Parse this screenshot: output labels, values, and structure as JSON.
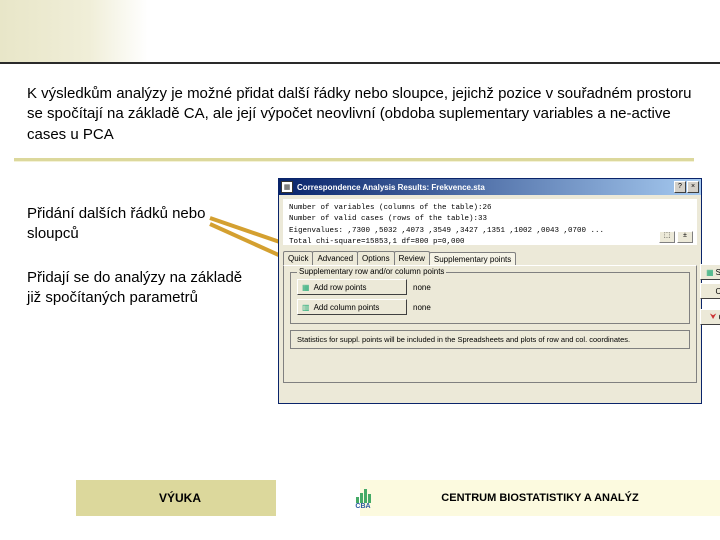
{
  "main_text": "K výsledkům analýzy je možné přidat další řádky nebo sloupce, jejichž pozice v souřadném prostoru se spočítají na základě CA, ale její výpočet neovlivní (obdoba suplementary variables a ne-active cases u PCA",
  "label1": "Přidání dalších řádků nebo sloupců",
  "label2": "Přidají se do analýzy na základě již spočítaných parametrů",
  "dialog": {
    "title": "Correspondence Analysis Results: Frekvence.sta",
    "stats": {
      "line1": "Number of variables (columns of the table):26",
      "line2": " Number of valid cases (rows of the table):33",
      "line3": "Eigenvalues: ,7300 ,5032 ,4073 ,3549 ,3427 ,1351 ,1002 ,0043 ,0700 ...",
      "line4": "Total chi-square=15853,1  df=800 p=0,000"
    },
    "tabs": [
      "Quick",
      "Advanced",
      "Options",
      "Review",
      "Supplementary points"
    ],
    "selected_tab": 4,
    "group_label": "Supplementary row and/or column points",
    "btn_rows": "Add row points",
    "btn_cols": "Add column points",
    "none": "none",
    "note": "Statistics for suppl. points will be included in the Spreadsheets and plots of row and col. coordinates.",
    "summary_btn": "Summary",
    "cancel_btn": "Cancel",
    "options_btn": "Options"
  },
  "footer": {
    "left": "VÝUKA",
    "right": "CENTRUM BIOSTATISTIKY A ANALÝZ",
    "logo": "CBA"
  }
}
